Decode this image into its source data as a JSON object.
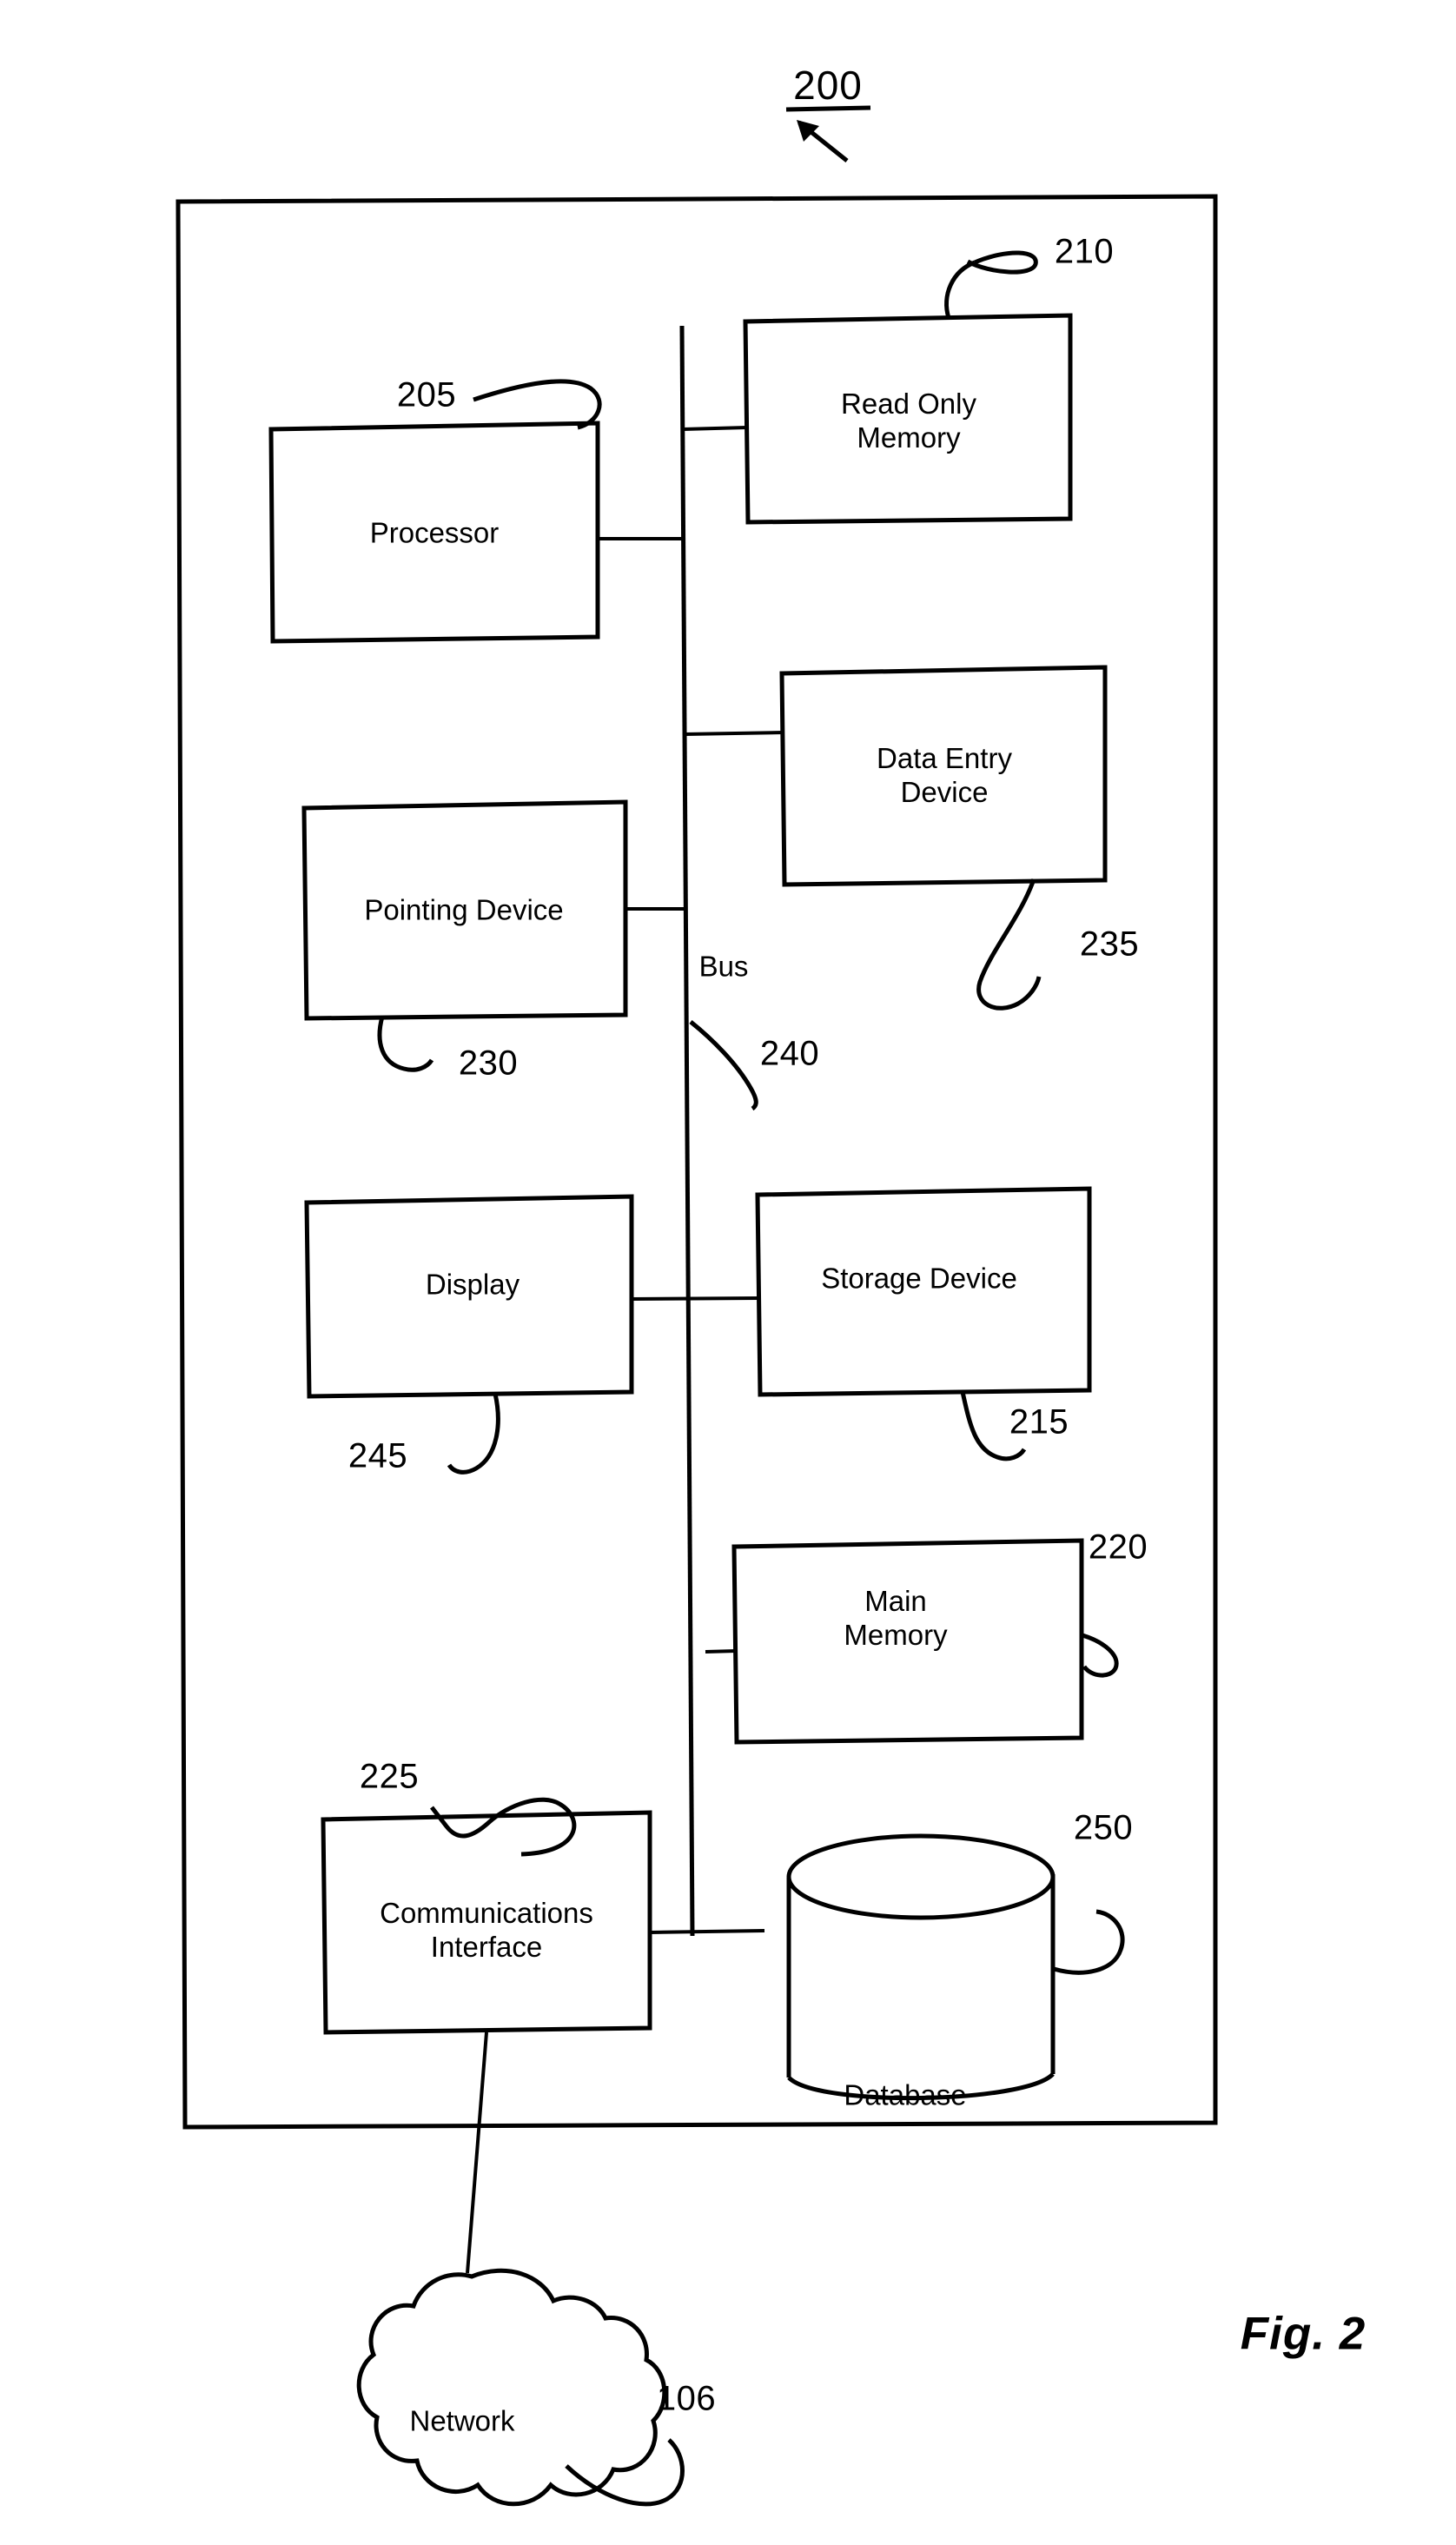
{
  "figure": {
    "caption": "Fig. 2",
    "system_ref": "200"
  },
  "outer_container": {
    "ref": "200"
  },
  "bus": {
    "label": "Bus",
    "ref": "240"
  },
  "blocks": [
    {
      "id": "processor",
      "label": "Processor",
      "ref": "205"
    },
    {
      "id": "read-only-memory",
      "label": "Read Only\nMemory",
      "ref": "210"
    },
    {
      "id": "storage-device",
      "label": "Storage Device",
      "ref": "215"
    },
    {
      "id": "main-memory",
      "label": "Main\nMemory",
      "ref": "220"
    },
    {
      "id": "communications-interface",
      "label": "Communications\nInterface",
      "ref": "225"
    },
    {
      "id": "pointing-device",
      "label": "Pointing Device",
      "ref": "230"
    },
    {
      "id": "data-entry-device",
      "label": "Data Entry\nDevice",
      "ref": "235"
    },
    {
      "id": "display",
      "label": "Display",
      "ref": "245"
    }
  ],
  "database": {
    "label": "Database",
    "ref": "250"
  },
  "network": {
    "label": "Network",
    "ref": "106"
  },
  "labels": {
    "processor": "Processor",
    "processor_ref": "205",
    "rom_line1": "Read Only",
    "rom_line2": "Memory",
    "rom_ref": "210",
    "data_entry_line1": "Data Entry",
    "data_entry_line2": "Device",
    "data_entry_ref": "235",
    "pointing_device": "Pointing Device",
    "pointing_device_ref": "230",
    "bus": "Bus",
    "bus_ref": "240",
    "display": "Display",
    "display_ref": "245",
    "storage_device": "Storage Device",
    "storage_device_ref": "215",
    "main_memory_line1": "Main",
    "main_memory_line2": "Memory",
    "main_memory_ref": "220",
    "comm_interface_line1": "Communications",
    "comm_interface_line2": "Interface",
    "comm_interface_ref": "225",
    "database": "Database",
    "database_ref": "250",
    "network": "Network",
    "network_ref": "106",
    "system_ref": "200",
    "fig_caption": "Fig. 2"
  },
  "style": {
    "ink": "#000000",
    "paper": "#ffffff"
  }
}
